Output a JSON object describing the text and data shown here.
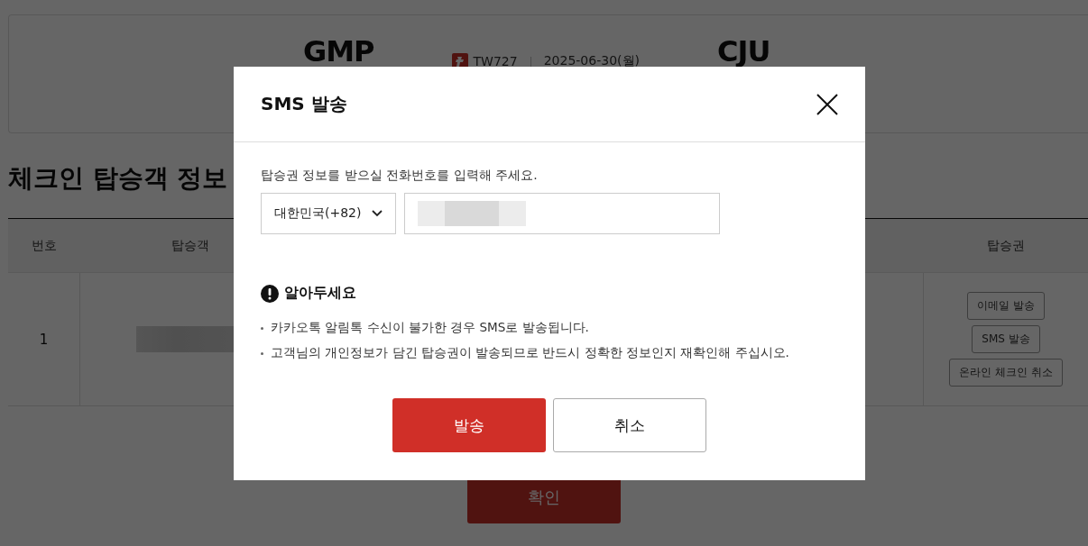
{
  "flight": {
    "origin": "GMP",
    "flight_number": "TW727",
    "date": "2025-06-30(월)",
    "destination": "CJU"
  },
  "section_title": "체크인 탑승객 정보",
  "table": {
    "columns": [
      "번호",
      "탑승객",
      "탑승권"
    ],
    "rows": [
      {
        "number": "1",
        "ticket_actions": [
          "이메일 발송",
          "SMS 발송",
          "온라인 체크인 취소"
        ]
      }
    ]
  },
  "confirm_button": "확인",
  "dialog": {
    "title": "SMS 발송",
    "prompt": "탑승권 정보를 받으실 전화번호를 입력해 주세요.",
    "country_select": {
      "value": "대한민국(+82)"
    },
    "notice": {
      "title": "알아두세요",
      "items": [
        "카카오톡 알림톡 수신이 불가한 경우 SMS로 발송됩니다.",
        "고객님의 개인정보가 담긴 탑승권이 발송되므로 반드시 정확한 정보인지 재확인해 주십시오."
      ]
    },
    "buttons": [
      {
        "label": "발송",
        "kind": "primary"
      },
      {
        "label": "취소",
        "kind": "secondary"
      }
    ]
  }
}
